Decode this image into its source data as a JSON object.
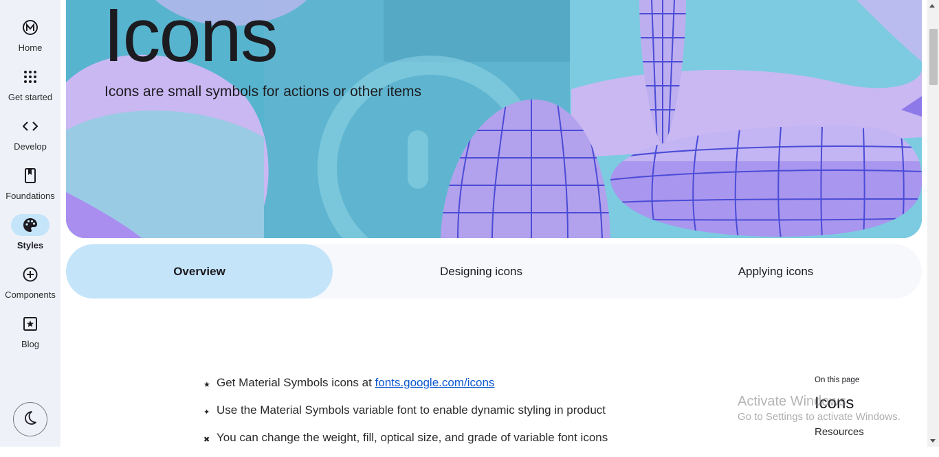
{
  "nav": {
    "items": [
      {
        "label": "Home",
        "icon": "material-logo-icon"
      },
      {
        "label": "Get started",
        "icon": "apps-grid-icon"
      },
      {
        "label": "Develop",
        "icon": "code-icon"
      },
      {
        "label": "Foundations",
        "icon": "book-icon"
      },
      {
        "label": "Styles",
        "icon": "palette-icon",
        "active": true
      },
      {
        "label": "Components",
        "icon": "add-circle-icon"
      },
      {
        "label": "Blog",
        "icon": "star-frame-icon"
      }
    ],
    "theme_toggle_icon": "dark-mode-moon-icon"
  },
  "hero": {
    "title": "Icons",
    "subtitle": "Icons are small symbols for actions or other items"
  },
  "tabs": [
    {
      "label": "Overview",
      "active": true
    },
    {
      "label": "Designing icons"
    },
    {
      "label": "Applying icons"
    }
  ],
  "bullets": [
    {
      "text": "Get Material Symbols icons at ",
      "link": "fonts.google.com/icons",
      "marker": "★"
    },
    {
      "text": "Use the Material Symbols variable font to enable dynamic styling in product",
      "marker": "✦"
    },
    {
      "text": "You can change the weight, fill, optical size, and grade of variable font icons",
      "marker": "✖"
    }
  ],
  "toc": {
    "heading": "On this page",
    "items": [
      "Icons",
      "Resources"
    ]
  },
  "watermark": {
    "title": "Activate Windows",
    "subtitle": "Go to Settings to activate Windows."
  },
  "colors": {
    "rail_bg": "#eef2f8",
    "active_pill": "#c4e4fa",
    "hero_teal": "#63bcd6",
    "hero_lavender": "#c9b8f2",
    "grid_line": "#4a4bd6",
    "link": "#0b57d0"
  }
}
